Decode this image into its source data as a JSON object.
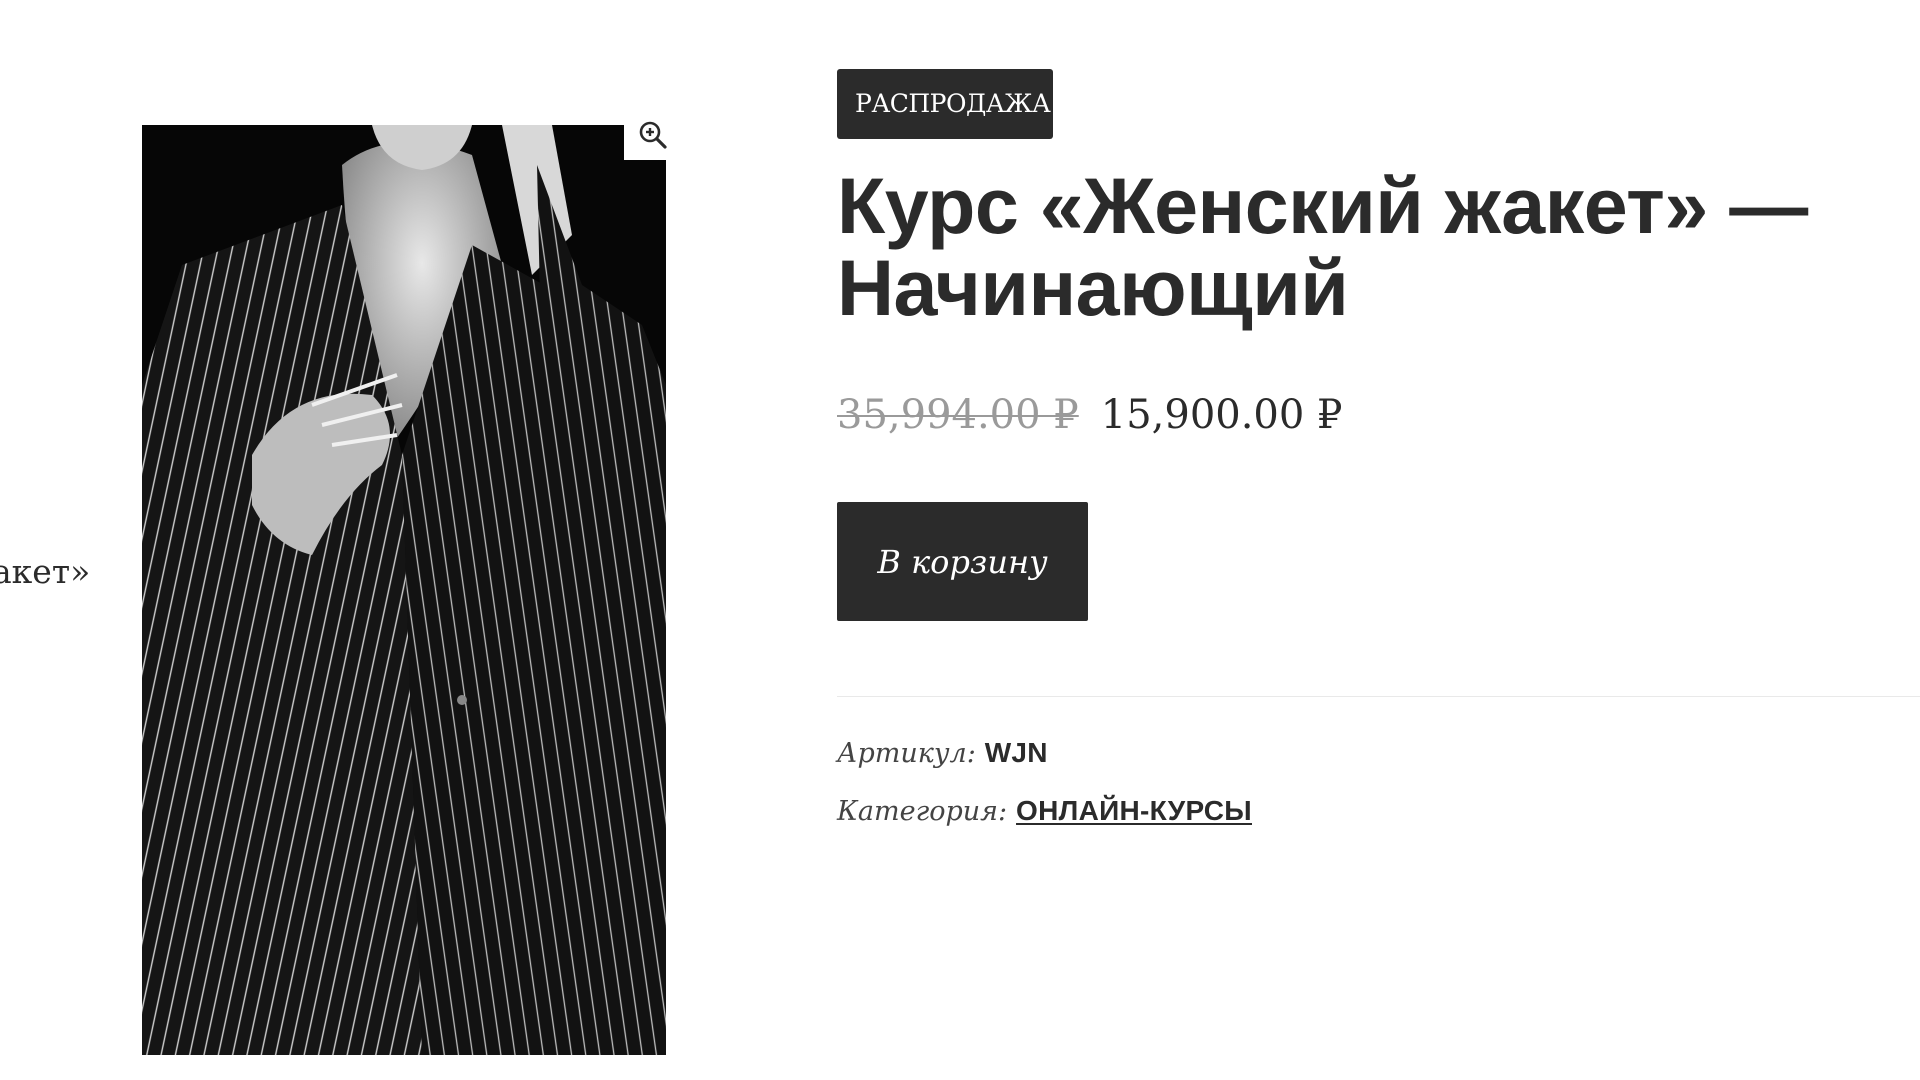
{
  "side_text": "акет»",
  "gallery": {
    "image_alt": "Женщина в тёмном жакете в тонкую полоску (чёрно-белое фото)",
    "zoom_icon": "zoom-in-icon"
  },
  "product": {
    "badge": "РАСПРОДАЖА!",
    "title": "Курс «Женский жакет» — Начинающий",
    "price_old": "35,994.00 ₽",
    "price_new": "15,900.00 ₽",
    "add_to_cart_label": "В корзину",
    "meta": {
      "sku_label": "Артикул:",
      "sku_value": "WJN",
      "category_label": "Категория:",
      "category_value": "ОНЛАЙН-КУРСЫ"
    }
  },
  "colors": {
    "text": "#2b2b2b",
    "old_price": "#9a9a9a",
    "button_bg": "#2b2b2b",
    "button_text": "#ffffff"
  }
}
